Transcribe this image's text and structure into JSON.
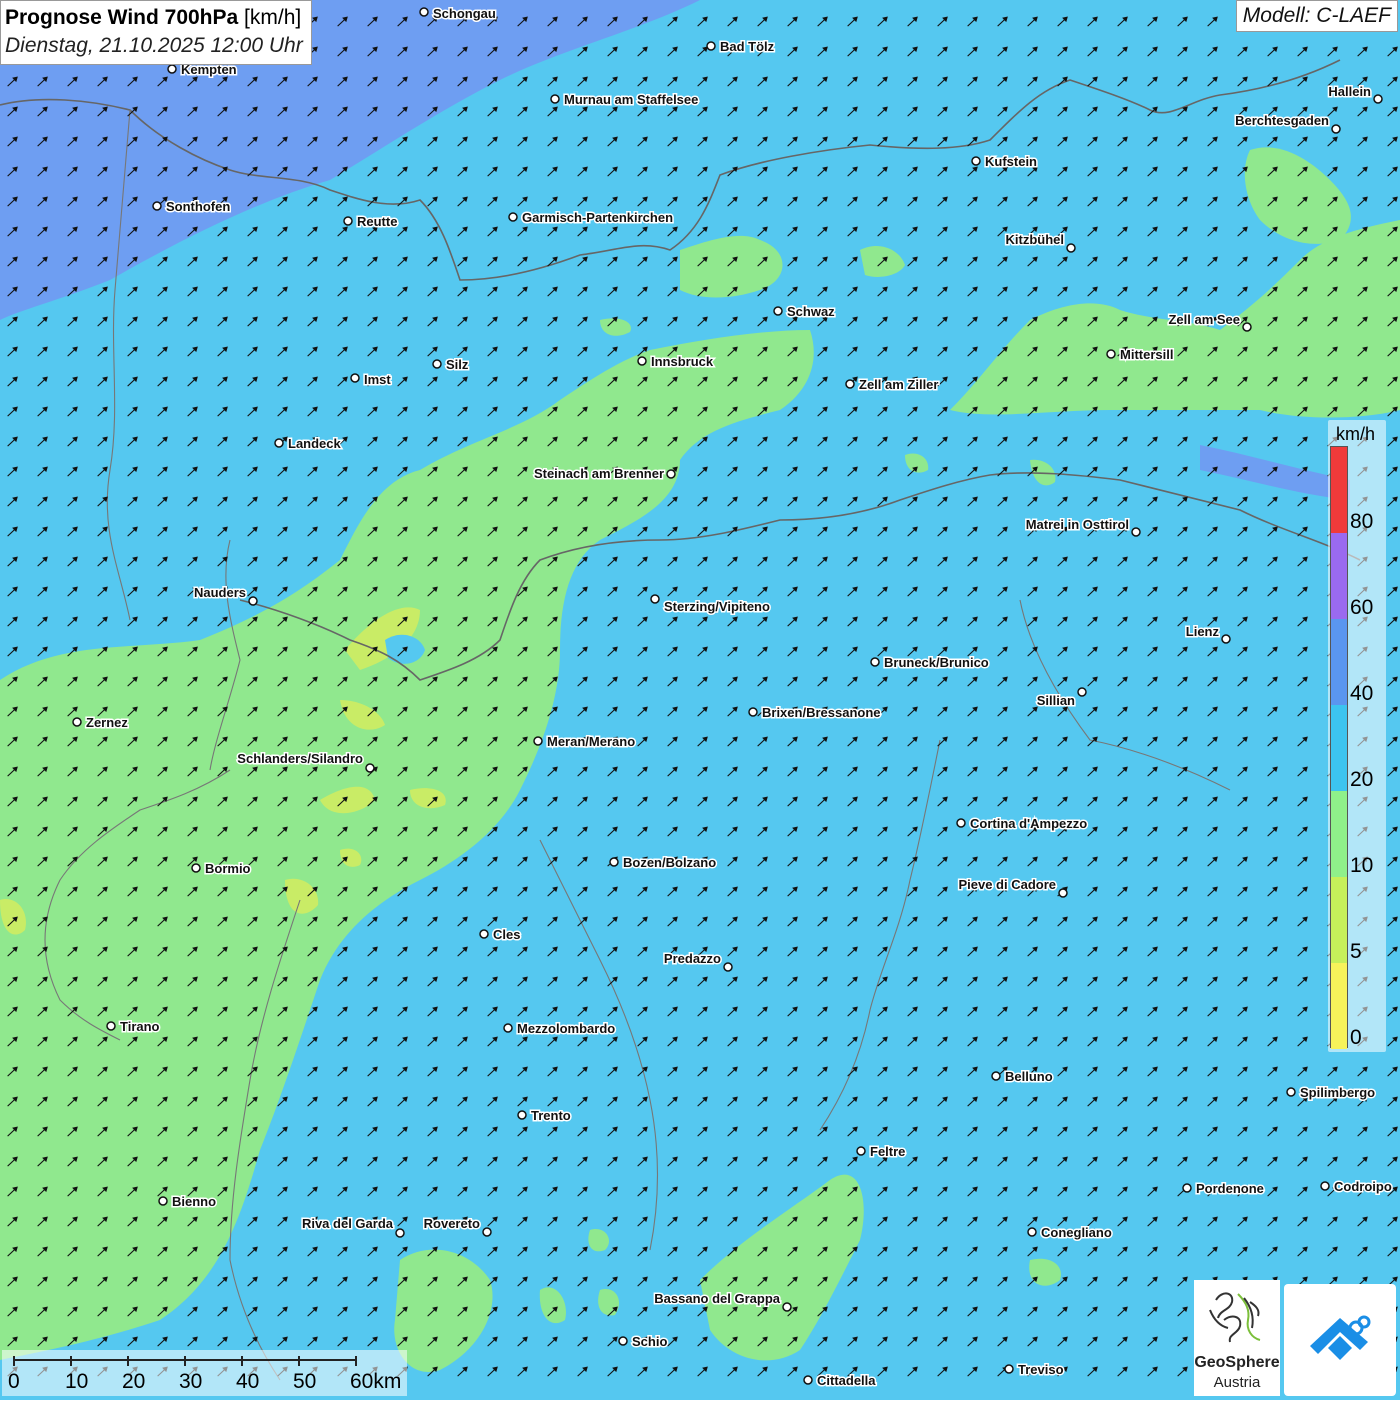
{
  "header": {
    "title_bold": "Prognose Wind 700hPa",
    "title_unit": "[km/h]",
    "datetime": "Dienstag, 21.10.2025 12:00 Uhr",
    "model": "Modell: C-LAEF"
  },
  "legend": {
    "unit": "km/h",
    "ticks": [
      "0",
      "5",
      "10",
      "20",
      "40",
      "60",
      "80"
    ],
    "colors": [
      "#f7f35a",
      "#c6f05a",
      "#8ff08a",
      "#3cc4f0",
      "#5a96f0",
      "#9a6af0",
      "#f03a3a"
    ]
  },
  "scale_bar": {
    "labels": [
      "0",
      "10",
      "20",
      "30",
      "40",
      "50",
      "60km"
    ]
  },
  "logos": {
    "geosphere_line1": "GeoSphere",
    "geosphere_line2": "Austria"
  },
  "map_colors": {
    "base_wind_20_40": "#55c8f0",
    "wind_10_20": "#8fe88c",
    "wind_40_60": "#6c9cf0",
    "wind_5_10": "#c8ec64",
    "borders": "#666666",
    "arrows": "#111111"
  },
  "cities": [
    {
      "name": "Schongau"
    },
    {
      "name": "Bad Tölz"
    },
    {
      "name": "Kempten"
    },
    {
      "name": "Murnau am Staffelsee"
    },
    {
      "name": "Hallein"
    },
    {
      "name": "Berchtesgaden"
    },
    {
      "name": "Kufstein"
    },
    {
      "name": "Sonthofen"
    },
    {
      "name": "Reutte"
    },
    {
      "name": "Garmisch-Partenkirchen"
    },
    {
      "name": "Kitzbühel"
    },
    {
      "name": "Schwaz"
    },
    {
      "name": "Zell am See"
    },
    {
      "name": "Innsbruck"
    },
    {
      "name": "Mittersill"
    },
    {
      "name": "Silz"
    },
    {
      "name": "Imst"
    },
    {
      "name": "Zell am Ziller"
    },
    {
      "name": "Landeck"
    },
    {
      "name": "Steinach am Brenner"
    },
    {
      "name": "Matrei in Osttirol"
    },
    {
      "name": "Nauders"
    },
    {
      "name": "Sterzing/Vipiteno"
    },
    {
      "name": "Lienz"
    },
    {
      "name": "Bruneck/Brunico"
    },
    {
      "name": "Sillian"
    },
    {
      "name": "Brixen/Bressanone"
    },
    {
      "name": "Zernez"
    },
    {
      "name": "Meran/Merano"
    },
    {
      "name": "Schlanders/Silandro"
    },
    {
      "name": "Cortina d'Ampezzo"
    },
    {
      "name": "Bozen/Bolzano"
    },
    {
      "name": "Bormio"
    },
    {
      "name": "Pieve di Cadore"
    },
    {
      "name": "Cles"
    },
    {
      "name": "Predazzo"
    },
    {
      "name": "Tirano"
    },
    {
      "name": "Mezzolombardo"
    },
    {
      "name": "Belluno"
    },
    {
      "name": "Spilimbergo"
    },
    {
      "name": "Trento"
    },
    {
      "name": "Feltre"
    },
    {
      "name": "Pordenone"
    },
    {
      "name": "Codroipo"
    },
    {
      "name": "Bienno"
    },
    {
      "name": "Riva del Garda"
    },
    {
      "name": "Rovereto"
    },
    {
      "name": "Conegliano"
    },
    {
      "name": "Bassano del Grappa"
    },
    {
      "name": "Schio"
    },
    {
      "name": "Treviso"
    },
    {
      "name": "Cittadella"
    }
  ]
}
